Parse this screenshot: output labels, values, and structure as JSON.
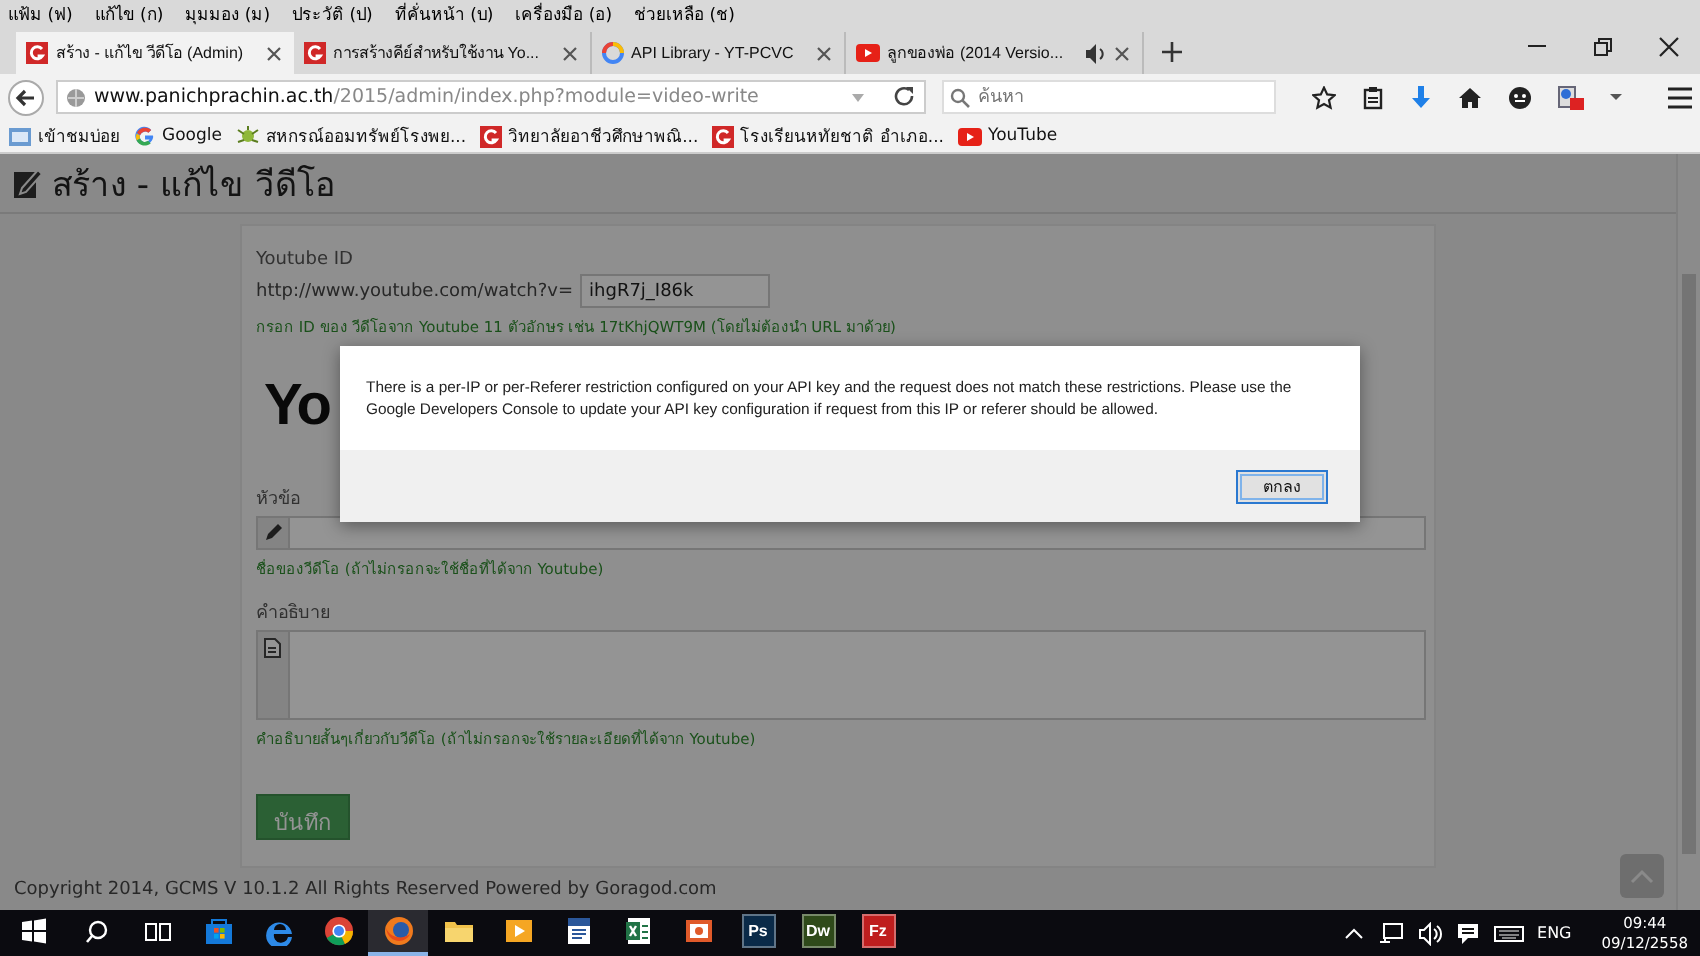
{
  "menu_bar": [
    "แฟ้ม (ฟ)",
    "แก้ไข (ก)",
    "มุมมอง (ม)",
    "ประวัติ (ป)",
    "ที่คั่นหน้า (บ)",
    "เครื่องมือ (อ)",
    "ช่วยเหลือ (ช)"
  ],
  "tabs": [
    {
      "label": "สร้าง - แก้ไข วีดีโอ (Admin)",
      "kind": "gcms",
      "selected": true,
      "audio": false
    },
    {
      "label": "การสร้างคีย์สำหรับใช้งาน Yo...",
      "kind": "gcms",
      "selected": false,
      "audio": false
    },
    {
      "label": "API Library - YT-PCVC",
      "kind": "cloud",
      "selected": false,
      "audio": false
    },
    {
      "label": "ลูกของพ่อ (2014 Versio...",
      "kind": "youtube",
      "selected": false,
      "audio": true
    }
  ],
  "address_bar": {
    "host": "www.panichprachin.ac.th",
    "path": "/2015/admin/index.php?module=video-write"
  },
  "search": {
    "placeholder": "ค้นหา"
  },
  "bookmarks": [
    {
      "label": "เข้าชมบ่อย",
      "kind": "folder"
    },
    {
      "label": "Google",
      "kind": "google"
    },
    {
      "label": "สหกรณ์ออมทรัพย์โรงพย...",
      "kind": "bug"
    },
    {
      "label": "วิทยาลัยอาชีวศึกษาพณิ...",
      "kind": "gcms"
    },
    {
      "label": "โรงเรียนหทัยชาติ อำเภอ...",
      "kind": "gcms"
    },
    {
      "label": "YouTube",
      "kind": "youtube"
    }
  ],
  "page": {
    "title": "สร้าง - แก้ไข วีดีโอ",
    "youtube_id": {
      "label": "Youtube ID",
      "prefix": "http://www.youtube.com/watch?v=",
      "value": "ihgR7j_I86k",
      "hint": "กรอก ID ของ วีดีโอจาก Youtube 11 ตัวอักษร เช่น 17tKhjQWT9M (โดยไม่ต้องนำ URL มาด้วย)"
    },
    "logo_text": "Yo",
    "title_field": {
      "label": "หัวข้อ",
      "hint": "ชื่อของวีดีโอ (ถ้าไม่กรอกจะใช้ชื่อที่ได้จาก Youtube)"
    },
    "description_field": {
      "label": "คำอธิบาย",
      "hint": "คำอธิบายสั้นๆเกี่ยวกับวีดีโอ (ถ้าไม่กรอกจะใช้รายละเอียดที่ได้จาก Youtube)"
    },
    "save_button": "บันทึก",
    "footer": "Copyright 2014, GCMS V 10.1.2 All Rights Reserved Powered by Goragod.com"
  },
  "dialog": {
    "message": "There is a per-IP or per-Referer restriction configured on your API key and the request does not match these restrictions. Please use the Google Developers Console to update your API key configuration if request from this IP or referer should be allowed.",
    "button": "ตกลง"
  },
  "taskbar": {
    "apps": [
      {
        "kind": "store",
        "selected": false
      },
      {
        "kind": "edge",
        "selected": false
      },
      {
        "kind": "chrome",
        "selected": false
      },
      {
        "kind": "firefox",
        "selected": true
      },
      {
        "kind": "folder",
        "selected": false
      },
      {
        "kind": "media",
        "selected": false
      },
      {
        "kind": "doc",
        "selected": false
      },
      {
        "kind": "sheet",
        "selected": false
      },
      {
        "kind": "slides",
        "selected": false
      },
      {
        "kind": "tile",
        "glyph": "Ps",
        "color": "#0a2a48",
        "selected": false
      },
      {
        "kind": "tile",
        "glyph": "Dw",
        "color": "#2f4a1a",
        "selected": false
      },
      {
        "kind": "tile",
        "glyph": "Fz",
        "color": "#bf1e1e",
        "selected": false
      }
    ],
    "language": "ENG",
    "time": "09:44",
    "date": "09/12/2558"
  }
}
